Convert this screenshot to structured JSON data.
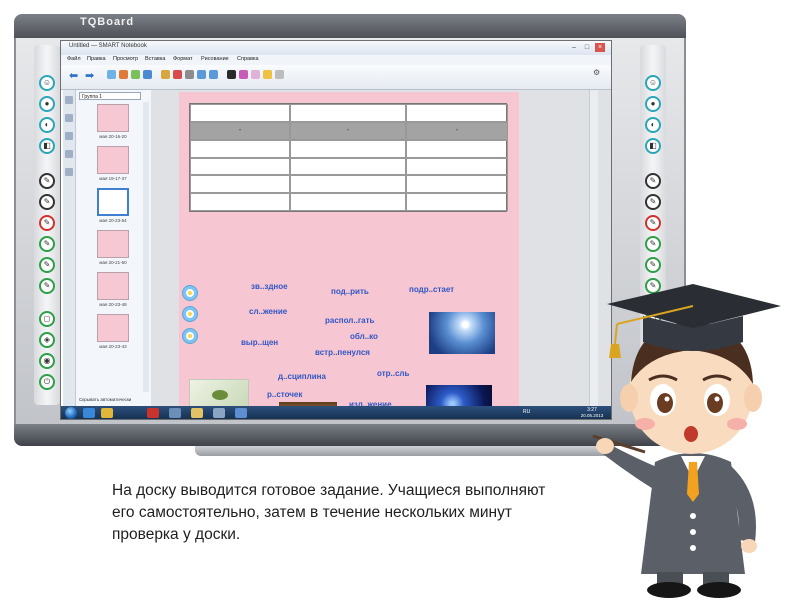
{
  "board": {
    "brand": "TQBoard"
  },
  "app": {
    "title": "Untitled — SMART Notebook",
    "window_controls": [
      "–",
      "□",
      "×"
    ],
    "menu": [
      "Файл",
      "Правка",
      "Просмотр",
      "Вставка",
      "Формат",
      "Рисование",
      "Справка"
    ]
  },
  "sorter": {
    "group_label": "Группа 1",
    "thumbnails": [
      "мая 20-16-20",
      "мая 19-17-37",
      "мая 20-23-54",
      "мая 20-21-50",
      "мая 20-23-48",
      "мая 20-23-43"
    ],
    "selected_index": 2,
    "auto_hide_label": "Скрывать автоматически"
  },
  "table": {
    "rows": 6,
    "cols": 3,
    "header_marks": [
      "•",
      "•",
      "•"
    ]
  },
  "words": [
    {
      "text": "зв..здное"
    },
    {
      "text": "под..рить"
    },
    {
      "text": "подр..стает"
    },
    {
      "text": "сл..жение"
    },
    {
      "text": "распол..гать"
    },
    {
      "text": "обл..ко"
    },
    {
      "text": "выр..щен"
    },
    {
      "text": "встр..пенулся"
    },
    {
      "text": "д..сциплина"
    },
    {
      "text": "отр..сль"
    },
    {
      "text": "р..сточек"
    },
    {
      "text": "изл..жение"
    }
  ],
  "taskbar": {
    "language": "RU",
    "time": "3:27",
    "date": "20.05.2013"
  },
  "caption": "На доску выводится готовое задание. Учащиеся выполняют его самостоятельно, затем в течение нескольких минут проверка у доски.",
  "colors": {
    "page_background": "#f6c6d2",
    "word_text": "#3156c4",
    "table_header": "#a3a3a3"
  },
  "icons": [
    "back-arrow-icon",
    "forward-arrow-icon",
    "pen-icon",
    "eraser-icon",
    "select-pointer-icon",
    "flower-bullet-icon",
    "graduation-cap-icon"
  ]
}
